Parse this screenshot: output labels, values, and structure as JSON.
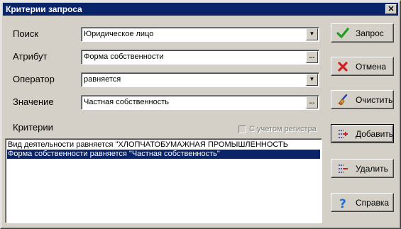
{
  "window": {
    "title": "Критерии запроса",
    "close_glyph": "✕"
  },
  "form": {
    "search": {
      "label": "Поиск",
      "value": "Юридическое лицо",
      "control": "dropdown"
    },
    "attribute": {
      "label": "Атрибут",
      "value": "Форма собственности",
      "control": "ellipsis"
    },
    "operator": {
      "label": "Оператор",
      "value": "равняется",
      "control": "dropdown"
    },
    "value": {
      "label": "Значение",
      "value": "Частная собственность",
      "control": "ellipsis"
    }
  },
  "criteria": {
    "label": "Критерии",
    "case_sensitive": {
      "label": "С учетом регистра",
      "checked": false,
      "enabled": false
    },
    "items": [
      "Вид деятельности равняется \"ХЛОПЧАТОБУМАЖНАЯ ПРОМЫШЛЕННОСТЬ",
      "Форма собственности равняется \"Частная собственность\""
    ],
    "selected_index": 1
  },
  "buttons": {
    "query": "Запрос",
    "cancel": "Отмена",
    "clear": "Очистить",
    "add": "Добавить",
    "delete": "Удалить",
    "help": "Справка"
  },
  "glyphs": {
    "dropdown": "▼",
    "ellipsis": "..."
  },
  "colors": {
    "titlebar": "#0a246a",
    "selection": "#0a246a",
    "face": "#d4d0c8",
    "check_green": "#1f9e1f",
    "cancel_red": "#d42020",
    "help_blue": "#1e6fd8"
  }
}
